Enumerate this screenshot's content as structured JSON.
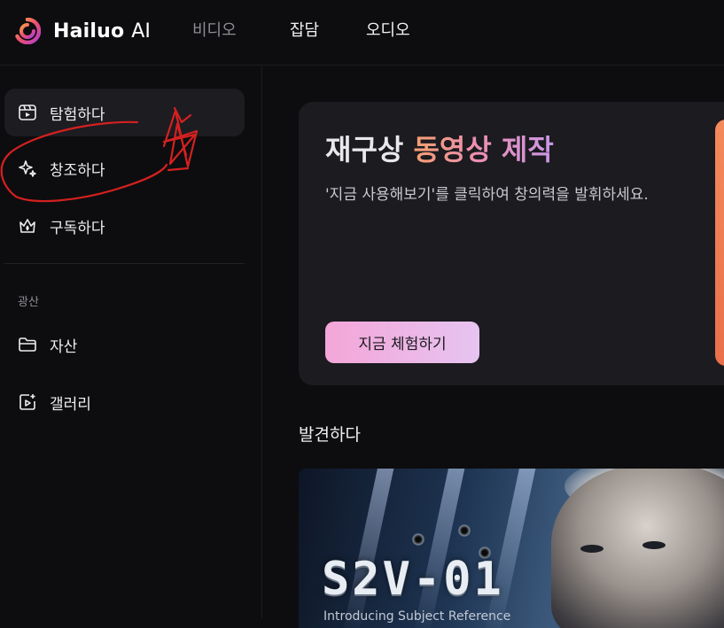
{
  "app": {
    "logo_text": "Hailuo",
    "logo_suffix": "AI"
  },
  "topnav": {
    "video": "비디오",
    "chat": "잡담",
    "audio": "오디오"
  },
  "sidebar": {
    "items": [
      {
        "label": "탐험하다",
        "icon": "film-icon",
        "active": true
      },
      {
        "label": "창조하다",
        "icon": "sparkles-icon",
        "active": false
      },
      {
        "label": "구독하다",
        "icon": "crown-icon",
        "active": false
      }
    ],
    "section_title": "광산",
    "section_items": [
      {
        "label": "자산",
        "icon": "folder-icon"
      },
      {
        "label": "갤러리",
        "icon": "gallery-icon"
      }
    ]
  },
  "hero": {
    "title_plain": "재구상",
    "title_highlight": "동영상 제작",
    "description": "'지금 사용해보기'를 클릭하여 창의력을 발휘하세요.",
    "button": "지금 체험하기"
  },
  "discover": {
    "heading": "발견하다"
  },
  "featured_card": {
    "title": "S2V-01",
    "subtitle": "Introducing Subject Reference"
  },
  "colors": {
    "background": "#0d0d0f",
    "accent_gradient_start": "#f49f6f",
    "accent_gradient_end": "#c996e6",
    "button_gradient_start": "#f4a6d8",
    "annotation_red": "#d42020"
  }
}
